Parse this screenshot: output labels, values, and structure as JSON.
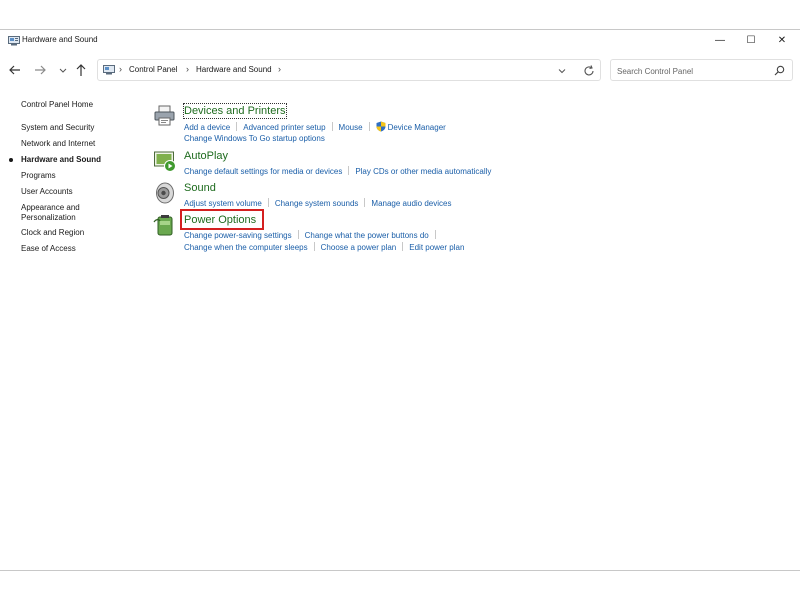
{
  "window": {
    "title": "Hardware and Sound",
    "controls": {
      "minimize": "—",
      "maximize": "☐",
      "close": "✕"
    }
  },
  "address": {
    "breadcrumbs": [
      "Control Panel",
      "Hardware and Sound"
    ],
    "search_placeholder": "Search Control Panel"
  },
  "sidebar": {
    "items": [
      {
        "label": "Control Panel Home",
        "active": false
      },
      {
        "label": "System and Security",
        "active": false
      },
      {
        "label": "Network and Internet",
        "active": false
      },
      {
        "label": "Hardware and Sound",
        "active": true
      },
      {
        "label": "Programs",
        "active": false
      },
      {
        "label": "User Accounts",
        "active": false
      },
      {
        "label": "Appearance and",
        "active": false
      },
      {
        "label": "Personalization",
        "active": false
      },
      {
        "label": "Clock and Region",
        "active": false
      },
      {
        "label": "Ease of Access",
        "active": false
      }
    ]
  },
  "categories": [
    {
      "title": "Devices and Printers",
      "icon": "printer-icon",
      "links_row1": [
        "Add a device",
        "Advanced printer setup",
        "Mouse",
        "Device Manager"
      ],
      "links_row2": [
        "Change Windows To Go startup options"
      ]
    },
    {
      "title": "AutoPlay",
      "icon": "autoplay-icon",
      "links_row1": [
        "Change default settings for media or devices",
        "Play CDs or other media automatically"
      ]
    },
    {
      "title": "Sound",
      "icon": "speaker-icon",
      "links_row1": [
        "Adjust system volume",
        "Change system sounds",
        "Manage audio devices"
      ]
    },
    {
      "title": "Power Options",
      "icon": "battery-icon",
      "highlight_color": "#d42020",
      "links_row1": [
        "Change power-saving settings",
        "Change what the power buttons do"
      ],
      "links_row2": [
        "Change when the computer sleeps",
        "Choose a power plan",
        "Edit power plan"
      ]
    }
  ],
  "colors": {
    "category_title": "#1e6b1e",
    "link": "#1a5ea8",
    "highlight": "#d42020"
  }
}
